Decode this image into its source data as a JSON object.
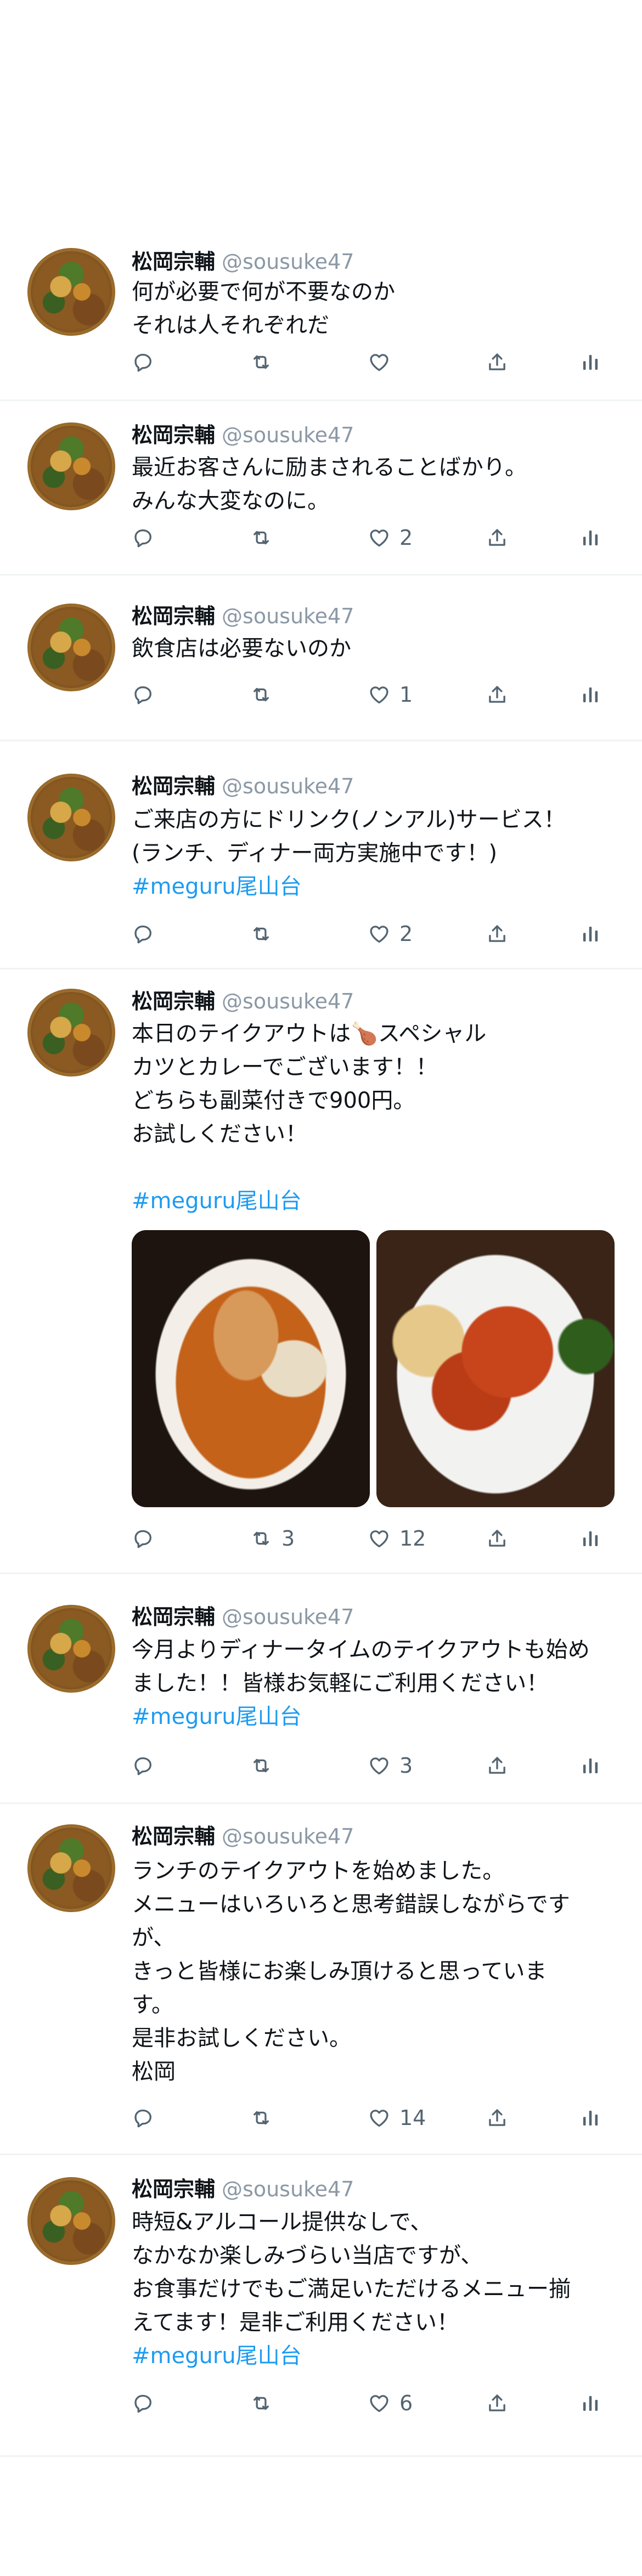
{
  "feed": {
    "tweets": [
      {
        "name": "松岡宗輔",
        "handle": "@sousuke47",
        "lines": [
          "何が必要で何が不要なのか",
          "それは人それぞれだ"
        ],
        "hashtag": "",
        "retweets": "",
        "likes": ""
      },
      {
        "name": "松岡宗輔",
        "handle": "@sousuke47",
        "lines": [
          "最近お客さんに励まされることばかり。",
          "みんな大変なのに。"
        ],
        "hashtag": "",
        "retweets": "",
        "likes": "2"
      },
      {
        "name": "松岡宗輔",
        "handle": "@sousuke47",
        "lines": [
          "飲食店は必要ないのか"
        ],
        "hashtag": "",
        "retweets": "",
        "likes": "1"
      },
      {
        "name": "松岡宗輔",
        "handle": "@sousuke47",
        "lines": [
          "ご来店の方にドリンク(ノンアル)サービス！",
          "(ランチ、ディナー両方実施中です！)"
        ],
        "hashtag": "#meguru尾山台",
        "retweets": "",
        "likes": "2"
      },
      {
        "name": "松岡宗輔",
        "handle": "@sousuke47",
        "lines": [
          "本日のテイクアウトは🍗スペシャル",
          "カツとカレーでございます！！",
          "どちらも副菜付きで900円。",
          "お試しください！",
          ""
        ],
        "hashtag": "#meguru尾山台",
        "retweets": "3",
        "likes": "12",
        "media": [
          "chicken-curry-photo",
          "cutlet-photo"
        ]
      },
      {
        "name": "松岡宗輔",
        "handle": "@sousuke47",
        "lines": [
          "今月よりディナータイムのテイクアウトも始め",
          "ました！！皆様お気軽にご利用ください！"
        ],
        "hashtag": "#meguru尾山台",
        "retweets": "",
        "likes": "3"
      },
      {
        "name": "松岡宗輔",
        "handle": "@sousuke47",
        "lines": [
          "ランチのテイクアウトを始めました。",
          "メニューはいろいろと思考錯誤しながらです",
          "が、",
          "きっと皆様にお楽しみ頂けると思っていま",
          "す。",
          "是非お試しください。",
          "松岡"
        ],
        "hashtag": "",
        "retweets": "",
        "likes": "14"
      },
      {
        "name": "松岡宗輔",
        "handle": "@sousuke47",
        "lines": [
          "時短&アルコール提供なしで、",
          "なかなか楽しみづらい当店ですが、",
          "お食事だけでもご満足いただけるメニュー揃",
          "えてます！是非ご利用ください！"
        ],
        "hashtag": "#meguru尾山台",
        "retweets": "",
        "likes": "6"
      }
    ]
  },
  "colors": {
    "text": "#0f1419",
    "handle": "#8b98a5",
    "hashtag": "#1d9bf0",
    "icon": "#536471",
    "separator": "#eff3f4"
  },
  "icons": [
    "reply-icon",
    "retweet-icon",
    "like-icon",
    "share-icon",
    "stats-icon"
  ]
}
